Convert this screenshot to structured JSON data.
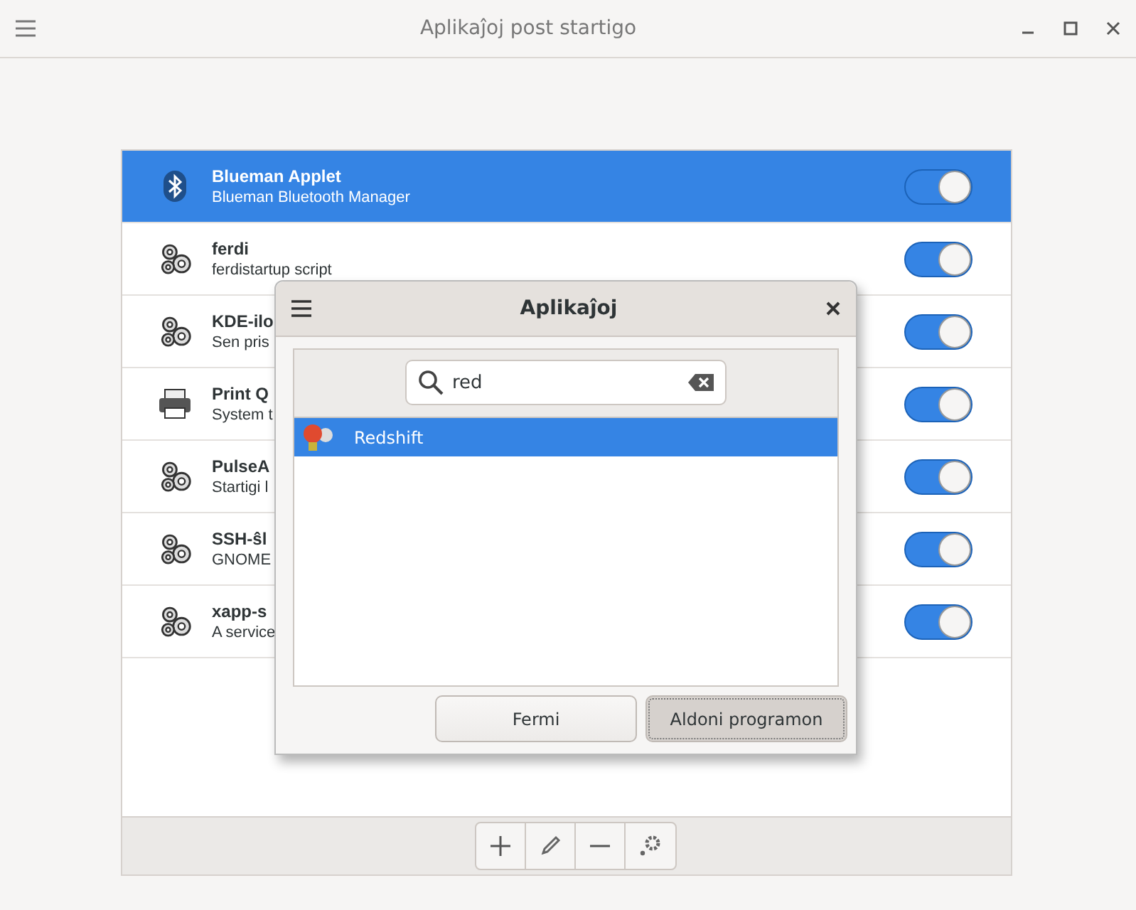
{
  "window": {
    "title": "Aplikaĵoj post startigo"
  },
  "apps": [
    {
      "kind": "bluetooth",
      "name": "Blueman Applet",
      "description": "Blueman Bluetooth Manager",
      "selected": true,
      "on": true
    },
    {
      "kind": "gears",
      "name": "ferdi",
      "description": "ferdistartup script",
      "selected": false,
      "on": true
    },
    {
      "kind": "gears",
      "name": "KDE-ilo",
      "description": "Sen pris",
      "selected": false,
      "on": true
    },
    {
      "kind": "printer",
      "name": "Print Q",
      "description": "System t",
      "selected": false,
      "on": true
    },
    {
      "kind": "gears",
      "name": "PulseA",
      "description": "Startigi l",
      "selected": false,
      "on": true
    },
    {
      "kind": "gears",
      "name": "SSH-ŝl",
      "description": "GNOME",
      "selected": false,
      "on": true
    },
    {
      "kind": "gears",
      "name": "xapp-s",
      "description": "A service",
      "selected": false,
      "on": true
    }
  ],
  "toolbar": [
    {
      "kind": "add"
    },
    {
      "kind": "edit"
    },
    {
      "kind": "remove"
    },
    {
      "kind": "settings"
    }
  ],
  "dialog": {
    "title": "Aplikaĵoj",
    "search": {
      "value": "red"
    },
    "results": [
      {
        "name": "Redshift",
        "selected": true
      }
    ],
    "buttons": [
      {
        "label": "Fermi",
        "focused": false
      },
      {
        "label": "Aldoni programon",
        "focused": true
      }
    ]
  }
}
